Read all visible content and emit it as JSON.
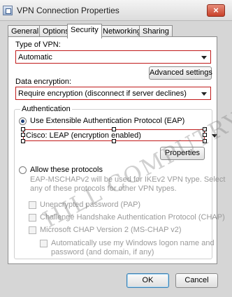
{
  "window": {
    "title": "VPN Connection Properties",
    "close_label": "×"
  },
  "tabs": [
    "General",
    "Options",
    "Security",
    "Networking",
    "Sharing"
  ],
  "active_tab": "Security",
  "vpn_type": {
    "label": "Type of VPN:",
    "value": "Automatic"
  },
  "advanced_settings_label": "Advanced settings",
  "encryption": {
    "label": "Data encryption:",
    "value": "Require encryption (disconnect if server declines)"
  },
  "authentication": {
    "group_label": "Authentication",
    "eap_option": "Use Extensible Authentication Protocol (EAP)",
    "eap_method": "Cisco: LEAP (encryption enabled)",
    "properties_label": "Properties",
    "allow_option": "Allow these protocols",
    "note_line1": "EAP-MSCHAPv2 will be used for IKEv2 VPN type. Select",
    "note_line2": "any of these protocols for other VPN types.",
    "protocols": [
      "Unencrypted password (PAP)",
      "Challenge Handshake Authentication Protocol (CHAP)",
      "Microsoft CHAP Version 2 (MS-CHAP v2)"
    ],
    "auto_logon_line1": "Automatically use my Windows logon name and",
    "auto_logon_line2": "password (and domain, if any)"
  },
  "footer": {
    "ok_label": "OK",
    "cancel_label": "Cancel"
  },
  "watermark": "HILL COMPUTRY"
}
